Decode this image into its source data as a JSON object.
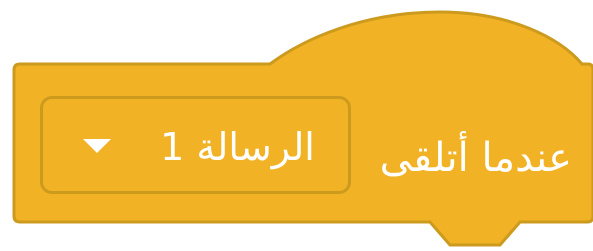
{
  "block": {
    "label": "عندما أتلقى",
    "message_value": "الرسالة 1",
    "arrow_icon": "dropdown-triangle-icon",
    "colors": {
      "fill": "#f2b226",
      "border": "#cc9a1d",
      "text": "#ffffff"
    }
  }
}
